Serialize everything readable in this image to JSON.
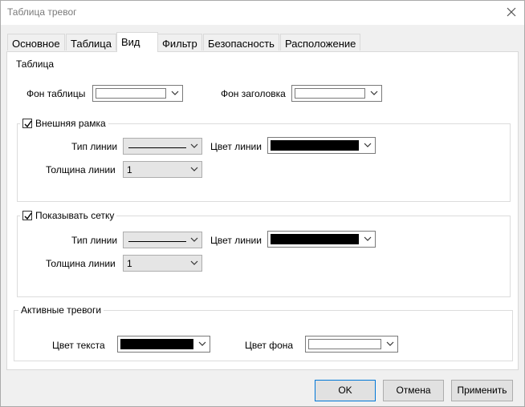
{
  "window": {
    "title": "Таблица тревог"
  },
  "tabs": [
    {
      "label": "Основное"
    },
    {
      "label": "Таблица"
    },
    {
      "label": "Вид"
    },
    {
      "label": "Фильтр"
    },
    {
      "label": "Безопасность"
    },
    {
      "label": "Расположение"
    }
  ],
  "active_tab": "Вид",
  "table_section": {
    "heading": "Таблица",
    "table_bg_label": "Фон таблицы",
    "table_bg_color": "#ffffff",
    "header_bg_label": "Фон заголовка",
    "header_bg_color": "#ffffff"
  },
  "outer_frame": {
    "checkbox_label": "Внешняя рамка",
    "checked": true,
    "line_type_label": "Тип линии",
    "line_type_value": "___________",
    "line_color_label": "Цвет линии",
    "line_color": "#000000",
    "line_width_label": "Толщина линии",
    "line_width_value": "1"
  },
  "grid": {
    "checkbox_label": "Показывать сетку",
    "checked": true,
    "line_type_label": "Тип линии",
    "line_type_value": "___________",
    "line_color_label": "Цвет линии",
    "line_color": "#000000",
    "line_width_label": "Толщина линии",
    "line_width_value": "1"
  },
  "active_alarms": {
    "heading": "Активные тревоги",
    "text_color_label": "Цвет текста",
    "text_color": "#000000",
    "bg_color_label": "Цвет фона",
    "bg_color": "#ffffff"
  },
  "buttons": {
    "ok": "OK",
    "cancel": "Отмена",
    "apply": "Применить"
  }
}
